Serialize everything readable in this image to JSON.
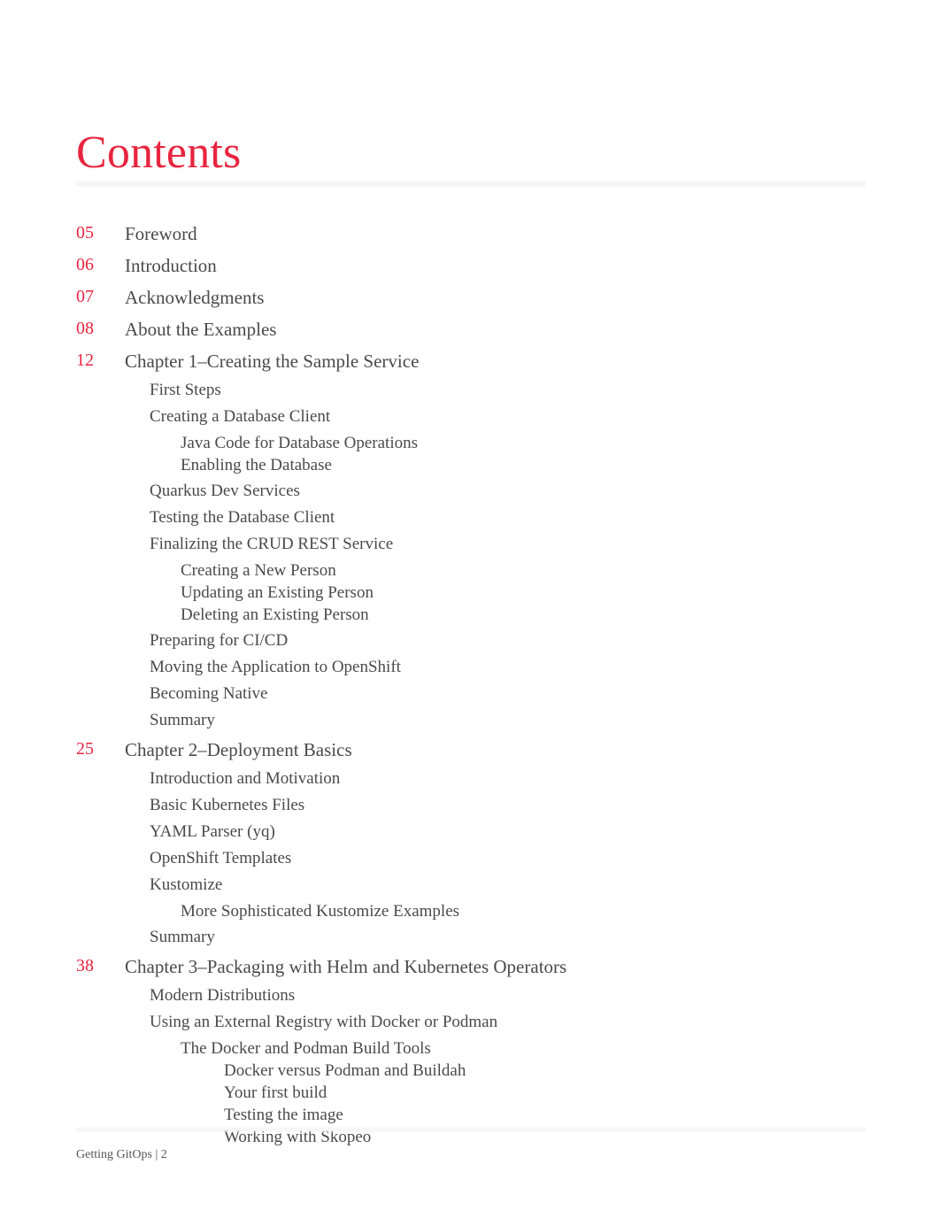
{
  "document": {
    "title": "Contents",
    "footer": "Getting GitOps | 2",
    "colors": {
      "accent_red": "#e8253f",
      "body_text": "#4a4a4a",
      "rule": "#f5f5f7"
    }
  },
  "toc": {
    "entries": [
      {
        "level": 0,
        "page": "05",
        "text": "Foreword"
      },
      {
        "level": 0,
        "page": "06",
        "text": "Introduction"
      },
      {
        "level": 0,
        "page": "07",
        "text": "Acknowledgments"
      },
      {
        "level": 0,
        "page": "08",
        "text": "About the Examples"
      },
      {
        "level": 0,
        "page": "12",
        "text": "Chapter 1–Creating the Sample Service"
      },
      {
        "level": 1,
        "text": "First Steps"
      },
      {
        "level": 1,
        "text": "Creating a Database Client"
      },
      {
        "level": 2,
        "text": "Java Code for Database Operations"
      },
      {
        "level": 2,
        "text": "Enabling the Database"
      },
      {
        "level": 1,
        "text": "Quarkus Dev Services"
      },
      {
        "level": 1,
        "text": "Testing the Database Client"
      },
      {
        "level": 1,
        "text": "Finalizing the CRUD REST Service"
      },
      {
        "level": 2,
        "text": "Creating a New Person"
      },
      {
        "level": 2,
        "text": "Updating an Existing Person"
      },
      {
        "level": 2,
        "text": "Deleting an Existing Person"
      },
      {
        "level": 1,
        "text": "Preparing for CI/CD"
      },
      {
        "level": 1,
        "text": "Moving the Application to OpenShift"
      },
      {
        "level": 1,
        "text": "Becoming Native"
      },
      {
        "level": 1,
        "text": "Summary"
      },
      {
        "level": 0,
        "page": "25",
        "text": "Chapter 2–Deployment Basics"
      },
      {
        "level": 1,
        "text": "Introduction and Motivation"
      },
      {
        "level": 1,
        "text": "Basic Kubernetes Files"
      },
      {
        "level": 1,
        "text": "YAML Parser (yq)"
      },
      {
        "level": 1,
        "text": "OpenShift Templates"
      },
      {
        "level": 1,
        "text": "Kustomize"
      },
      {
        "level": 2,
        "text": "More Sophisticated Kustomize Examples"
      },
      {
        "level": 1,
        "text": "Summary"
      },
      {
        "level": 0,
        "page": "38",
        "text": "Chapter 3–Packaging with Helm and Kubernetes Operators"
      },
      {
        "level": 1,
        "text": "Modern Distributions"
      },
      {
        "level": 1,
        "text": "Using an External Registry with Docker or Podman"
      },
      {
        "level": 2,
        "text": "The Docker and Podman Build Tools"
      },
      {
        "level": 3,
        "text": "Docker versus Podman and Buildah"
      },
      {
        "level": 3,
        "text": "Your first build"
      },
      {
        "level": 3,
        "text": "Testing the image"
      },
      {
        "level": 3,
        "text": "Working with Skopeo"
      }
    ]
  }
}
